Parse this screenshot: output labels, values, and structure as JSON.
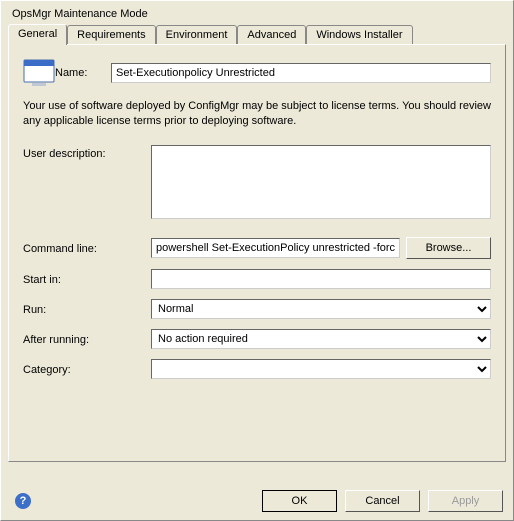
{
  "window": {
    "title": "OpsMgr Maintenance Mode"
  },
  "tabs": {
    "general": "General",
    "requirements": "Requirements",
    "environment": "Environment",
    "advanced": "Advanced",
    "installer": "Windows Installer"
  },
  "general": {
    "name_label": "Name:",
    "name_value": "Set-Executionpolicy Unrestricted",
    "info": "Your use of software deployed by ConfigMgr may be subject to license terms. You should review any applicable license terms prior to deploying software.",
    "userdesc_label": "User description:",
    "userdesc_value": "",
    "cmd_label": "Command line:",
    "cmd_value": "powershell Set-ExecutionPolicy unrestricted -forc",
    "browse_label": "Browse...",
    "startin_label": "Start in:",
    "startin_value": "",
    "run_label": "Run:",
    "run_value": "Normal",
    "after_label": "After running:",
    "after_value": "No action required",
    "category_label": "Category:",
    "category_value": ""
  },
  "footer": {
    "ok": "OK",
    "cancel": "Cancel",
    "apply": "Apply"
  },
  "icons": {
    "help": "?"
  }
}
